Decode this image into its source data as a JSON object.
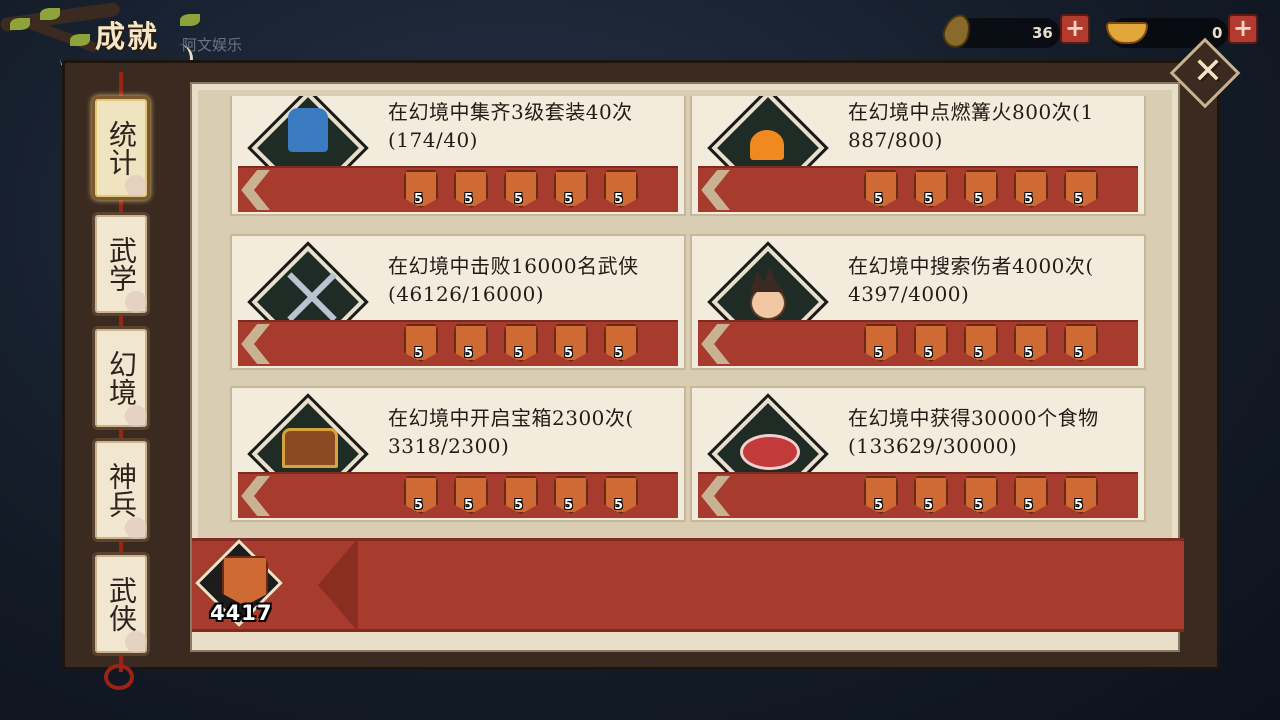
{
  "header": {
    "title": "成就",
    "subtitle": "阿文娱乐"
  },
  "resources": [
    {
      "name": "leaf-currency",
      "value": "36"
    },
    {
      "name": "gold-ingot",
      "value": "0"
    }
  ],
  "plus_label": "+",
  "close_label": "✕",
  "tabs": [
    {
      "label": "统计",
      "active": true
    },
    {
      "label": "武学",
      "active": false
    },
    {
      "label": "幻境",
      "active": false
    },
    {
      "label": "神兵",
      "active": false
    },
    {
      "label": "武侠",
      "active": false
    }
  ],
  "achievements": [
    {
      "icon": "armor-set-icon",
      "desc_line1": "在幻境中集齐3级套装40次",
      "desc_line2": "(174/40)",
      "rewards": [
        "5",
        "5",
        "5",
        "5",
        "5"
      ]
    },
    {
      "icon": "campfire-icon",
      "desc_line1": "在幻境中点燃篝火800次(1",
      "desc_line2": "887/800)",
      "rewards": [
        "5",
        "5",
        "5",
        "5",
        "5"
      ]
    },
    {
      "icon": "crossed-swords-icon",
      "desc_line1": "在幻境中击败16000名武侠",
      "desc_line2": "(46126/16000)",
      "rewards": [
        "5",
        "5",
        "5",
        "5",
        "5"
      ]
    },
    {
      "icon": "injured-man-icon",
      "desc_line1": "在幻境中搜索伤者4000次(",
      "desc_line2": "4397/4000)",
      "rewards": [
        "5",
        "5",
        "5",
        "5",
        "5"
      ]
    },
    {
      "icon": "treasure-chest-icon",
      "desc_line1": "在幻境中开启宝箱2300次(",
      "desc_line2": "3318/2300)",
      "rewards": [
        "5",
        "5",
        "5",
        "5",
        "5"
      ]
    },
    {
      "icon": "meat-icon",
      "desc_line1": "在幻境中获得30000个食物",
      "desc_line2": "(133629/30000)",
      "rewards": [
        "5",
        "5",
        "5",
        "5",
        "5"
      ]
    }
  ],
  "total_points": "4417",
  "colors": {
    "accent_red": "#a63b2e",
    "paper": "#f3ecdd",
    "frame": "#3a2a20",
    "reward_orange": "#d06a34"
  }
}
